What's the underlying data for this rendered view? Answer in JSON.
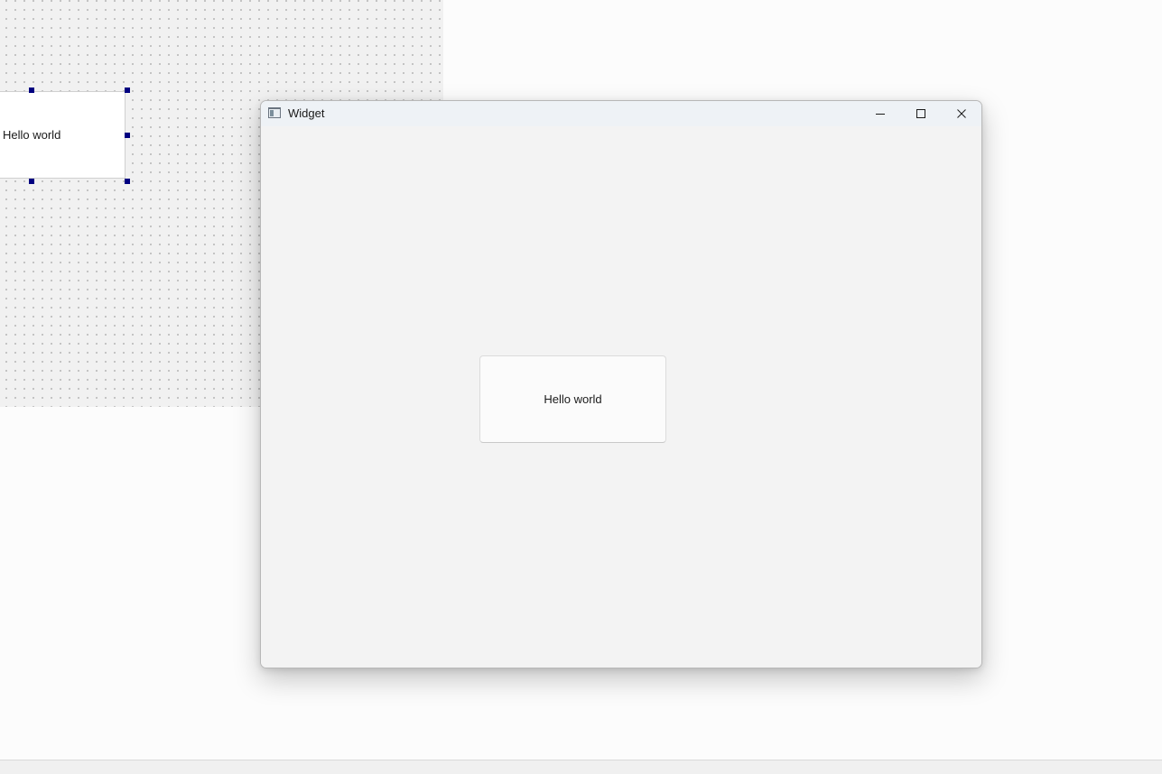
{
  "designer": {
    "button_label": "Hello world"
  },
  "window": {
    "title": "Widget",
    "controls": {
      "minimize_icon": "minimize-icon",
      "maximize_icon": "maximize-icon",
      "close_icon": "close-icon"
    },
    "button_label": "Hello world"
  },
  "colors": {
    "selection_handle": "#000080",
    "titlebar": "#eef2f6",
    "client": "#f3f3f3"
  }
}
